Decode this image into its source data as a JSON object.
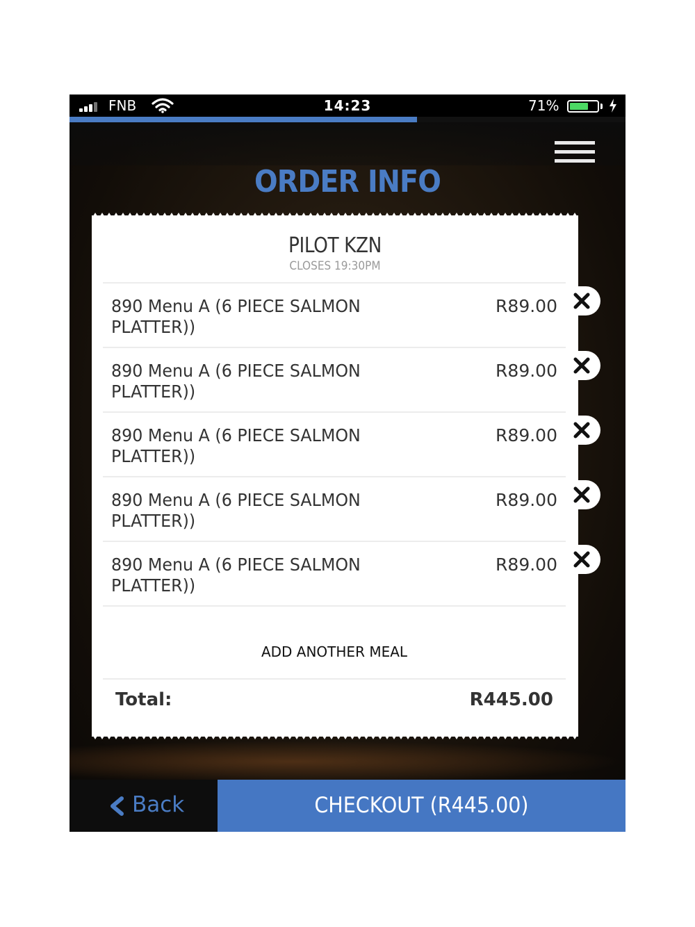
{
  "status_bar": {
    "carrier": "FNB",
    "time": "14:23",
    "battery_percent": "71%",
    "battery_level": 0.71
  },
  "progress": {
    "fraction": 0.625,
    "color": "#4a7cc4"
  },
  "header": {
    "title": "ORDER INFO",
    "menu_icon": "hamburger-menu-icon"
  },
  "receipt": {
    "restaurant": "PILOT KZN",
    "closing": "CLOSES 19:30PM",
    "items": [
      {
        "name": "890 Menu A (6 PIECE SALMON PLATTER))",
        "price": "R89.00"
      },
      {
        "name": "890 Menu A (6 PIECE SALMON PLATTER))",
        "price": "R89.00"
      },
      {
        "name": "890 Menu A (6 PIECE SALMON PLATTER))",
        "price": "R89.00"
      },
      {
        "name": "890 Menu A (6 PIECE SALMON PLATTER))",
        "price": "R89.00"
      },
      {
        "name": "890 Menu A (6 PIECE SALMON PLATTER))",
        "price": "R89.00"
      }
    ],
    "add_meal_label": "ADD ANOTHER MEAL",
    "total_label": "Total:",
    "total_value": "R445.00"
  },
  "footer": {
    "back_label": "Back",
    "checkout_label": "CHECKOUT (R445.00)"
  },
  "colors": {
    "accent": "#4a7cc4",
    "checkout_bg": "#4577c3",
    "battery_green": "#4cd964"
  }
}
